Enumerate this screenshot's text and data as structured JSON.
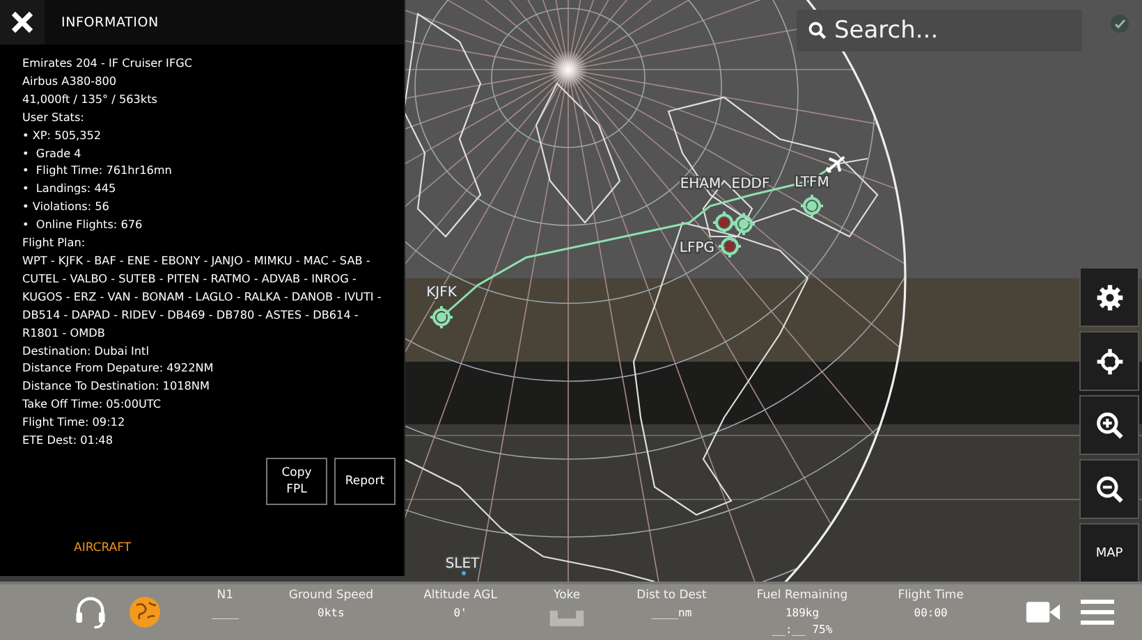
{
  "info_panel": {
    "title": "INFORMATION",
    "lines": [
      "Emirates 204 - IF Cruiser IFGC",
      "Airbus A380-800",
      "41,000ft / 135° / 563kts",
      "User Stats:",
      "• XP: 505,352",
      "•  Grade 4",
      "•  Flight Time: 761hr16mn",
      "•  Landings: 445",
      "• Violations: 56",
      "•  Online Flights: 676",
      "Flight Plan:",
      "WPT - KJFK - BAF - ENE - EBONY - JANJO - MIMKU - MAC - SAB - CUTEL - VALBO - SUTEB - PITEN - RATMO - ADVAB - INROG - KUGOS - ERZ - VAN - BONAM - LAGLO - RALKA - DANOB - IVUTI - DB514 - DAPAD - RIDEV - DB469 - DB780 - ASTES - DB614 - R1801 - OMDB",
      "Destination: Dubai Intl",
      "Distance From Depature: 4922NM",
      "Distance To Destination: 1018NM",
      "Take Off Time: 05:00UTC",
      "Flight Time: 09:12",
      "ETE Dest: 01:48"
    ],
    "buttons": [
      "Copy FPL",
      "Report"
    ],
    "footer_link": "AIRCRAFT"
  },
  "search": {
    "placeholder": "Search..."
  },
  "map": {
    "airports": [
      {
        "label": "KJFK",
        "color": "#8ee0b0"
      },
      {
        "label": "EHAM",
        "color": "#8b2a2a"
      },
      {
        "label": "EDDF",
        "color": "#8ee0b0"
      },
      {
        "label": "LFPG",
        "color": "#8b2a2a"
      },
      {
        "label": "LTFM",
        "color": "#8ee0b0"
      },
      {
        "label": "SLET",
        "color": "#4aa8d8"
      }
    ]
  },
  "side_buttons": [
    {
      "kind": "settings"
    },
    {
      "kind": "locate"
    },
    {
      "kind": "zoom_in"
    },
    {
      "kind": "zoom_out"
    },
    {
      "kind": "text",
      "label": "MAP"
    }
  ],
  "bottom_bar": {
    "instruments": [
      {
        "label": "N1",
        "values": [
          "____"
        ]
      },
      {
        "label": "Ground Speed",
        "values": [
          "0kts"
        ]
      },
      {
        "label": "Altitude AGL",
        "values": [
          "0'"
        ]
      },
      {
        "label": "Yoke"
      },
      {
        "label": "Dist to Dest",
        "values": [
          "____nm"
        ]
      },
      {
        "label": "Fuel Remaining",
        "values": [
          "189kg",
          "__:__ 75%"
        ]
      },
      {
        "label": "Flight Time",
        "values": [
          "00:00"
        ]
      }
    ]
  }
}
